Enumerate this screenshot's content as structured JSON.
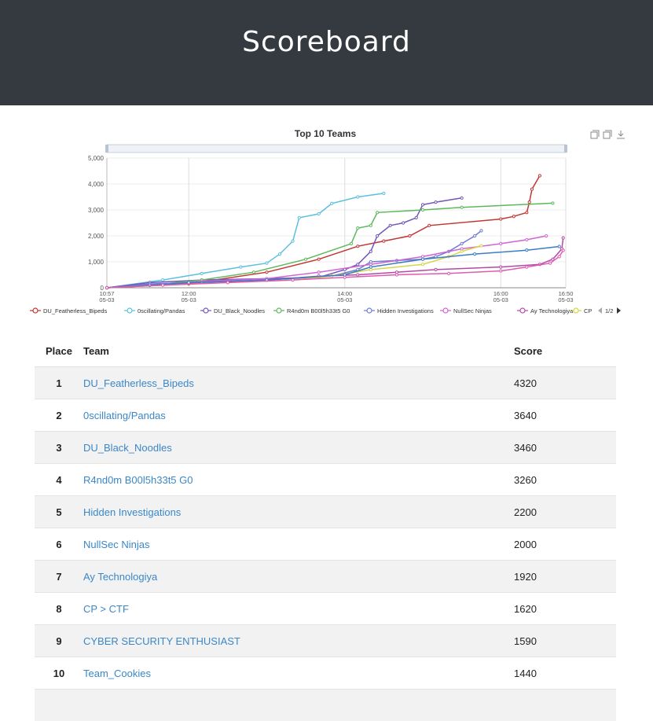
{
  "header": {
    "title": "Scoreboard"
  },
  "chart_data": {
    "type": "line",
    "title": "Top 10 Teams",
    "xlabel": "",
    "ylabel": "",
    "ylim": [
      0,
      5000
    ],
    "y_ticks": [
      "0",
      "1,000",
      "2,000",
      "3,000",
      "4,000",
      "5,000"
    ],
    "x_ticks": [
      {
        "time": "10:57",
        "date": "05-03"
      },
      {
        "time": "12:00",
        "date": "05-03"
      },
      {
        "time": "14:00",
        "date": "05-03"
      },
      {
        "time": "16:00",
        "date": "05-03"
      },
      {
        "time": "16:50",
        "date": "05-03"
      }
    ],
    "x_range": [
      "10:57",
      "16:50"
    ],
    "grid": "vertical",
    "legend_position": "bottom",
    "legend_page": "1/2",
    "toolbox_icons": [
      "zoom-icon",
      "zoom-reset-icon",
      "download-icon"
    ],
    "series": [
      {
        "name": "DU_Featherless_Bipeds",
        "color": "#c23531",
        "points": [
          [
            "10:57",
            0
          ],
          [
            "12:00",
            150
          ],
          [
            "13:00",
            600
          ],
          [
            "13:40",
            1100
          ],
          [
            "14:10",
            1600
          ],
          [
            "14:30",
            1800
          ],
          [
            "14:50",
            2000
          ],
          [
            "15:05",
            2400
          ],
          [
            "16:00",
            2650
          ],
          [
            "16:10",
            2750
          ],
          [
            "16:20",
            2900
          ],
          [
            "16:22",
            3300
          ],
          [
            "16:24",
            3800
          ],
          [
            "16:30",
            4320
          ]
        ]
      },
      {
        "name": "0scillating/Pandas",
        "color": "#5bc0de",
        "points": [
          [
            "10:57",
            0
          ],
          [
            "11:40",
            300
          ],
          [
            "12:10",
            550
          ],
          [
            "12:40",
            800
          ],
          [
            "13:00",
            950
          ],
          [
            "13:10",
            1300
          ],
          [
            "13:20",
            1800
          ],
          [
            "13:25",
            2700
          ],
          [
            "13:40",
            2850
          ],
          [
            "13:50",
            3250
          ],
          [
            "14:10",
            3500
          ],
          [
            "14:30",
            3640
          ]
        ]
      },
      {
        "name": "DU_Black_Noodles",
        "color": "#7256b8",
        "points": [
          [
            "10:57",
            0
          ],
          [
            "11:30",
            200
          ],
          [
            "12:10",
            300
          ],
          [
            "13:00",
            350
          ],
          [
            "13:40",
            400
          ],
          [
            "14:00",
            700
          ],
          [
            "14:10",
            900
          ],
          [
            "14:20",
            1400
          ],
          [
            "14:25",
            2000
          ],
          [
            "14:35",
            2400
          ],
          [
            "14:45",
            2500
          ],
          [
            "14:55",
            2700
          ],
          [
            "15:00",
            3200
          ],
          [
            "15:10",
            3300
          ],
          [
            "15:30",
            3460
          ]
        ]
      },
      {
        "name": "R4nd0m B00l5h33t5 G0",
        "color": "#5cb85c",
        "points": [
          [
            "10:57",
            0
          ],
          [
            "11:30",
            100
          ],
          [
            "12:10",
            300
          ],
          [
            "12:50",
            600
          ],
          [
            "13:30",
            1100
          ],
          [
            "14:05",
            1700
          ],
          [
            "14:10",
            2300
          ],
          [
            "14:20",
            2400
          ],
          [
            "14:25",
            2900
          ],
          [
            "15:00",
            3000
          ],
          [
            "15:30",
            3100
          ],
          [
            "16:40",
            3260
          ]
        ]
      },
      {
        "name": "Hidden Investigations",
        "color": "#6f7cd0",
        "points": [
          [
            "10:57",
            0
          ],
          [
            "11:30",
            150
          ],
          [
            "12:00",
            200
          ],
          [
            "13:00",
            300
          ],
          [
            "13:50",
            450
          ],
          [
            "14:10",
            700
          ],
          [
            "14:20",
            1000
          ],
          [
            "14:40",
            1050
          ],
          [
            "15:00",
            1100
          ],
          [
            "15:10",
            1200
          ],
          [
            "15:20",
            1400
          ],
          [
            "15:30",
            1700
          ],
          [
            "15:40",
            2000
          ],
          [
            "15:45",
            2200
          ]
        ]
      },
      {
        "name": "NullSec Ninjas",
        "color": "#d064d0",
        "points": [
          [
            "10:57",
            0
          ],
          [
            "11:30",
            100
          ],
          [
            "12:10",
            250
          ],
          [
            "13:00",
            350
          ],
          [
            "13:40",
            600
          ],
          [
            "14:20",
            900
          ],
          [
            "15:00",
            1200
          ],
          [
            "15:30",
            1500
          ],
          [
            "16:00",
            1700
          ],
          [
            "16:20",
            1850
          ],
          [
            "16:35",
            2000
          ]
        ]
      },
      {
        "name": "Ay Technologiya",
        "color": "#b44aa8",
        "points": [
          [
            "10:57",
            0
          ],
          [
            "11:30",
            100
          ],
          [
            "12:10",
            200
          ],
          [
            "13:00",
            300
          ],
          [
            "13:40",
            450
          ],
          [
            "14:10",
            500
          ],
          [
            "14:40",
            600
          ],
          [
            "15:10",
            700
          ],
          [
            "16:00",
            800
          ],
          [
            "16:30",
            900
          ],
          [
            "16:40",
            1100
          ],
          [
            "16:47",
            1500
          ],
          [
            "16:48",
            1920
          ]
        ]
      },
      {
        "name": "CP > CTF",
        "color": "#d5d54a",
        "points": [
          [
            "10:57",
            0
          ],
          [
            "11:40",
            100
          ],
          [
            "12:30",
            200
          ],
          [
            "13:20",
            300
          ],
          [
            "13:50",
            450
          ],
          [
            "14:20",
            700
          ],
          [
            "15:00",
            900
          ],
          [
            "15:20",
            1200
          ],
          [
            "15:30",
            1400
          ],
          [
            "15:45",
            1620
          ]
        ]
      },
      {
        "name": "CYBER SECURITY ENTHUSIAST",
        "color": "#3b7dc4",
        "points": [
          [
            "10:57",
            0
          ],
          [
            "11:30",
            100
          ],
          [
            "12:00",
            200
          ],
          [
            "13:00",
            300
          ],
          [
            "14:00",
            500
          ],
          [
            "14:20",
            800
          ],
          [
            "15:00",
            1100
          ],
          [
            "15:40",
            1300
          ],
          [
            "16:20",
            1450
          ],
          [
            "16:45",
            1590
          ]
        ]
      },
      {
        "name": "Team_Cookies",
        "color": "#e05ab0",
        "points": [
          [
            "10:57",
            0
          ],
          [
            "11:40",
            100
          ],
          [
            "12:30",
            200
          ],
          [
            "13:20",
            300
          ],
          [
            "14:00",
            400
          ],
          [
            "14:40",
            500
          ],
          [
            "15:20",
            550
          ],
          [
            "16:00",
            650
          ],
          [
            "16:20",
            800
          ],
          [
            "16:38",
            950
          ],
          [
            "16:45",
            1200
          ],
          [
            "16:48",
            1440
          ]
        ]
      }
    ],
    "legend_visible": [
      "DU_Featherless_Bipeds",
      "0scillating/Pandas",
      "DU_Black_Noodles",
      "R4nd0m B00l5h33t5 G0",
      "Hidden Investigations",
      "NullSec Ninjas",
      "Ay Technologiya",
      "CP"
    ]
  },
  "table": {
    "headers": {
      "place": "Place",
      "team": "Team",
      "score": "Score"
    },
    "rows": [
      {
        "place": "1",
        "team": "DU_Featherless_Bipeds",
        "score": "4320"
      },
      {
        "place": "2",
        "team": "0scillating/Pandas",
        "score": "3640"
      },
      {
        "place": "3",
        "team": "DU_Black_Noodles",
        "score": "3460"
      },
      {
        "place": "4",
        "team": "R4nd0m B00l5h33t5 G0",
        "score": "3260"
      },
      {
        "place": "5",
        "team": "Hidden Investigations",
        "score": "2200"
      },
      {
        "place": "6",
        "team": "NullSec Ninjas",
        "score": "2000"
      },
      {
        "place": "7",
        "team": "Ay Technologiya",
        "score": "1920"
      },
      {
        "place": "8",
        "team": "CP > CTF",
        "score": "1620"
      },
      {
        "place": "9",
        "team": "CYBER SECURITY ENTHUSIAST",
        "score": "1590"
      },
      {
        "place": "10",
        "team": "Team_Cookies",
        "score": "1440"
      }
    ]
  }
}
